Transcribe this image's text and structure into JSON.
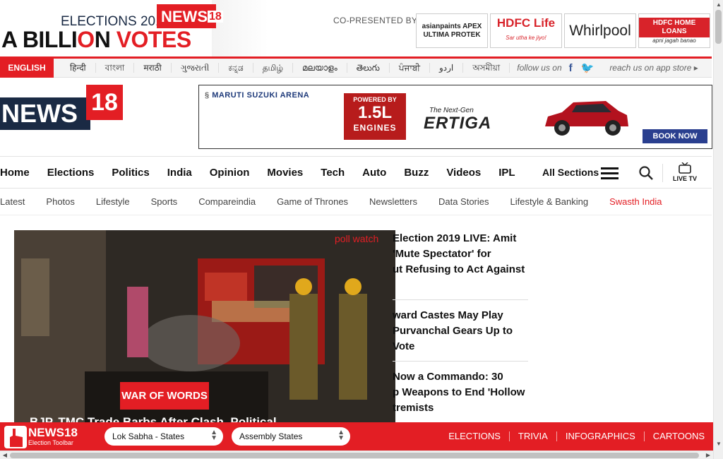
{
  "banner": {
    "elections_text": "ELECTIONS 2019",
    "news18_mini": "NEWS",
    "news18_mini_num": "18",
    "billion_prefix": "A BILLI",
    "billion_o": "O",
    "billion_n": "N",
    "votes": "VOTES",
    "copresented": "CO-PRESENTED BY",
    "sponsors": [
      {
        "name": "asianpaints APEX ULTIMA PROTEK"
      },
      {
        "name": "HDFC Life"
      },
      {
        "name": "Whirlpool"
      },
      {
        "name": "HDFC HOME LOANS"
      }
    ],
    "sponsor4_tag": "apni jagah banao",
    "sponsor2_tag": "Sar utha ke jiyo!"
  },
  "langbar": {
    "english": "ENGLISH",
    "languages": [
      "हिन्दी",
      "বাংলা",
      "मराठी",
      "ગુજરાતી",
      "ಕನ್ನಡ",
      "தமிழ்",
      "മലയാളം",
      "తెలుగు",
      "ਪੰਜਾਬੀ",
      "اردو",
      "অসমীয়া"
    ],
    "follow": "follow us on",
    "reach": "reach us on app store"
  },
  "logo": {
    "news": "NEWS",
    "num": "18"
  },
  "ad": {
    "brand": "MARUTI SUZUKI ARENA",
    "powered": "POWERED BY",
    "engine_size": "1.5L",
    "engines": "ENGINES",
    "nextgen": "The Next-Gen",
    "model": "ERTIGA",
    "cta": "BOOK NOW"
  },
  "mainnav": {
    "items": [
      "Home",
      "Elections",
      "Politics",
      "India",
      "Opinion",
      "Movies",
      "Tech",
      "Auto",
      "Buzz",
      "Videos",
      "IPL"
    ],
    "all_sections": "All Sections",
    "live_tv": "LIVE TV"
  },
  "subnav": {
    "items": [
      "Latest",
      "Photos",
      "Lifestyle",
      "Sports",
      "Compareindia",
      "Game of Thrones",
      "Newsletters",
      "Data Stories",
      "Lifestyle & Banking"
    ],
    "highlight": "Swasth India"
  },
  "hero": {
    "poll_tag": "poll watch",
    "badge": "WAR OF WORDS",
    "caption": "BJP, TMC Trade Barbs After Clash, Political..."
  },
  "stories": [
    {
      "line1": "Election 2019 LIVE: Amit",
      "line2": "'Mute Spectator' for",
      "line3": "ut Refusing to Act Against"
    },
    {
      "line1": "ward Castes May Play",
      "line2": "Purvanchal Gears Up to Vote",
      "line3": ""
    },
    {
      "line1": "Now a Commando: 30",
      "line2": "p Weapons to End 'Hollow",
      "line3": "tremists"
    }
  ],
  "toolbar": {
    "title": "NEWS18",
    "subtitle": "Election Toolbar",
    "select1": "Lok Sabha - States",
    "select2": "Assembly States",
    "links": [
      "ELECTIONS",
      "TRIVIA",
      "INFOGRAPHICS",
      "CARTOONS"
    ]
  },
  "colors": {
    "brand_red": "#e31e24",
    "navy": "#1a2a44"
  }
}
